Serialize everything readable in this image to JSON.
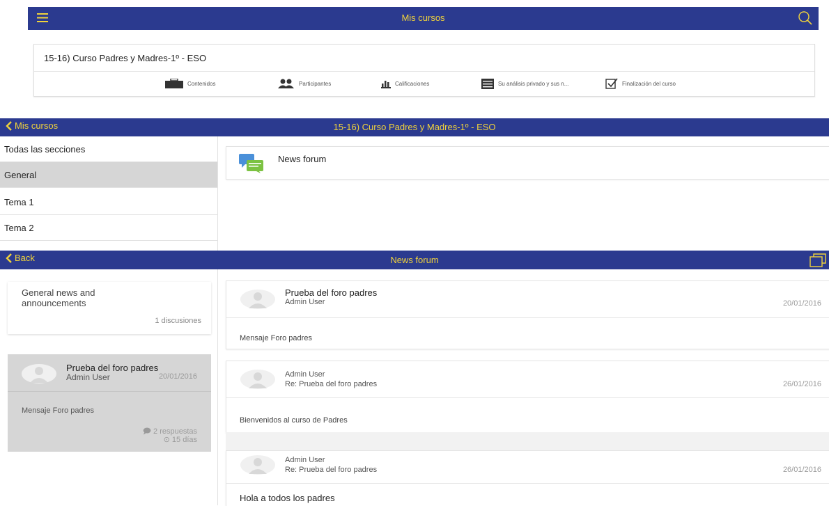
{
  "colors": {
    "bar_bg": "#2b3a8f",
    "bar_text": "#f1d33b",
    "selected_bg": "#d6d6d6"
  },
  "section1": {
    "title": "Mis cursos",
    "course_title": "15-16) Curso Padres y Madres-1º - ESO",
    "tools": [
      {
        "label": "Contenidos",
        "icon": "briefcase-icon"
      },
      {
        "label": "Participantes",
        "icon": "people-icon"
      },
      {
        "label": "Calificaciones",
        "icon": "bar-chart-icon"
      },
      {
        "label": "Su análisis privado y sus n...",
        "icon": "list-icon"
      },
      {
        "label": "Finalización del curso",
        "icon": "checkbox-icon"
      }
    ]
  },
  "section2": {
    "back_label": "Mis cursos",
    "title": "15-16) Curso Padres y Madres-1º - ESO",
    "sections": [
      "Todas las secciones",
      "General",
      "Tema 1",
      "Tema 2"
    ],
    "selected_section": "General",
    "module_name": "News forum"
  },
  "section3": {
    "back_label": "Back",
    "title": "News forum",
    "forum": {
      "name": "General news and announcements",
      "count": "1 discusiones"
    },
    "discussion": {
      "title": "Prueba del foro padres",
      "author": "Admin User",
      "date": "20/01/2016",
      "message": "Mensaje Foro padres",
      "replies": "2 respuestas",
      "age": "15 días"
    },
    "posts": [
      {
        "line1": "Prueba del foro padres",
        "line2": "Admin User",
        "date": "20/01/2016",
        "body": "Mensaje Foro padres"
      },
      {
        "line1": "Admin User",
        "line2": "Re: Prueba del foro padres",
        "date": "26/01/2016",
        "body": "Bienvenidos al curso de Padres"
      },
      {
        "line1": "Admin User",
        "line2": "Re: Prueba del foro padres",
        "date": "26/01/2016",
        "body": "Hola a todos los padres"
      }
    ]
  }
}
